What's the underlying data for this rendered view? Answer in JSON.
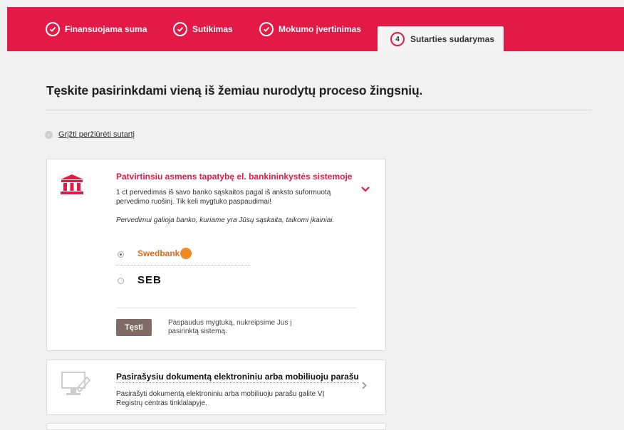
{
  "steps": [
    {
      "label": "Finansuojama suma"
    },
    {
      "label": "Sutikimas"
    },
    {
      "label": "Mokumo įvertinimas"
    },
    {
      "label": "Sutarties sudarymas",
      "number": "4"
    }
  ],
  "page": {
    "heading": "Tęskite pasirinkdami vieną iš žemiau nurodytų proceso žingsnių.",
    "back_link": "Grįžti peržiūrėti sutartį"
  },
  "bank_option": {
    "title": "Patvirtinsiu asmens tapatybę el. bankininkystės sistemoje",
    "desc": "1 ct pervedimas iš savo banko sąskaitos pagal iš anksto suformuotą pervedimo ruošinį. Tik keli mygtuko paspaudimai!",
    "note": "Pervedimui galioja banko, kuriame yra Jūsų sąskaita, taikomi įkainiai.",
    "banks": [
      "Swedbank",
      "SEB"
    ],
    "selected_bank": "Swedbank",
    "button": "Tęsti",
    "button_help": "Paspaudus mygtuką, nukreipsime Jus į pasirinktą sistemą."
  },
  "signature_option": {
    "title": "Pasirašysiu dokumentą elektroniniu arba mobiliuoju parašu",
    "desc": "Pasirašyti dokumentą elektroniniu arba mobiliuoju parašu galite VĮ Registrų centras tinklalapyje."
  },
  "colors": {
    "brand": "#e21a45",
    "button": "#7f6b63",
    "swedbank": "#e26b23"
  },
  "icons": [
    "check-icon",
    "bank-icon",
    "chevron-down-icon",
    "monitor-icon",
    "chevron-right-icon",
    "back-arrow-icon"
  ]
}
